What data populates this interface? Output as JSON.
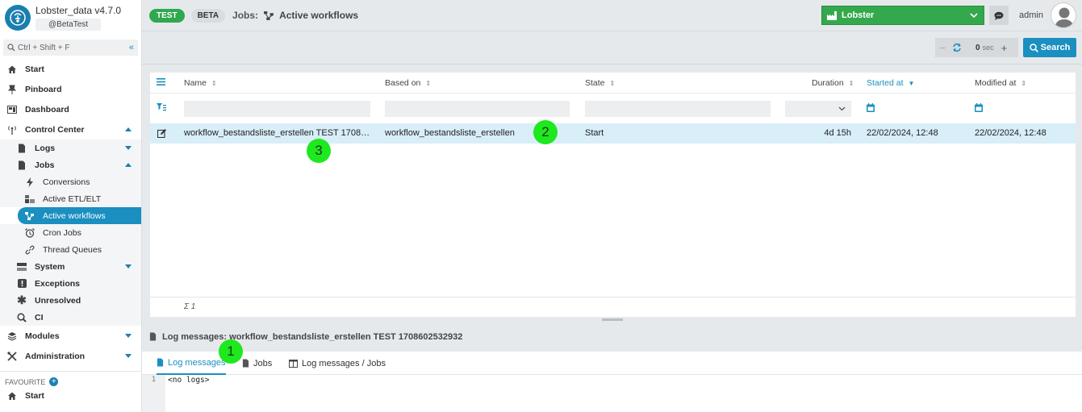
{
  "app": {
    "name": "Lobster_data v4.7.0",
    "user_tag": "@BetaTest"
  },
  "sidebar": {
    "search_placeholder": "Ctrl + Shift + F",
    "items": [
      {
        "label": "Start",
        "icon": "home-icon"
      },
      {
        "label": "Pinboard",
        "icon": "pin-icon"
      },
      {
        "label": "Dashboard",
        "icon": "dashboard-icon"
      },
      {
        "label": "Control Center",
        "icon": "antenna-icon"
      },
      {
        "label": "Logs",
        "icon": "file-icon"
      },
      {
        "label": "Jobs",
        "icon": "file-icon"
      },
      {
        "label": "Conversions",
        "icon": "bolt-icon"
      },
      {
        "label": "Active ETL/ELT",
        "icon": "etl-icon"
      },
      {
        "label": "Active workflows",
        "icon": "workflow-icon"
      },
      {
        "label": "Cron Jobs",
        "icon": "alarm-icon"
      },
      {
        "label": "Thread Queues",
        "icon": "link-icon"
      },
      {
        "label": "System",
        "icon": "server-icon"
      },
      {
        "label": "Exceptions",
        "icon": "exclamation-icon"
      },
      {
        "label": "Unresolved",
        "icon": "asterisk-icon"
      },
      {
        "label": "CI",
        "icon": "magnifier-icon"
      },
      {
        "label": "Modules",
        "icon": "layers-icon"
      },
      {
        "label": "Administration",
        "icon": "tools-icon"
      }
    ],
    "favourite_label": "FAVOURITE",
    "favourite_items": [
      {
        "label": "Start"
      }
    ]
  },
  "header": {
    "badge_test": "TEST",
    "badge_beta": "BETA",
    "crumb_jobs": "Jobs:",
    "title": "Active workflows",
    "environment": "Lobster",
    "user": "admin"
  },
  "toolbar": {
    "refresh_value": "0",
    "refresh_unit": "sec",
    "search_label": "Search"
  },
  "table": {
    "columns": {
      "name": "Name",
      "based_on": "Based on",
      "state": "State",
      "duration": "Duration",
      "started_at": "Started at",
      "modified_at": "Modified at"
    },
    "rows": [
      {
        "name": "workflow_bestandsliste_erstellen TEST 1708…",
        "based_on": "workflow_bestandsliste_erstellen",
        "state": "Start",
        "duration": "4d 15h",
        "started_at": "22/02/2024, 12:48",
        "modified_at": "22/02/2024, 12:48"
      }
    ],
    "sum": "Σ 1"
  },
  "log": {
    "title": "Log messages: workflow_bestandsliste_erstellen TEST 1708602532932",
    "tabs": [
      "Log messages",
      "Jobs",
      "Log messages / Jobs"
    ],
    "line_number": "1",
    "content": "<no logs>"
  },
  "markers": [
    "1",
    "2",
    "3"
  ],
  "colors": {
    "accent": "#1a8fc0",
    "env_green": "#34a84c",
    "test_badge": "#2fa84f",
    "marker": "#1ee81e"
  }
}
